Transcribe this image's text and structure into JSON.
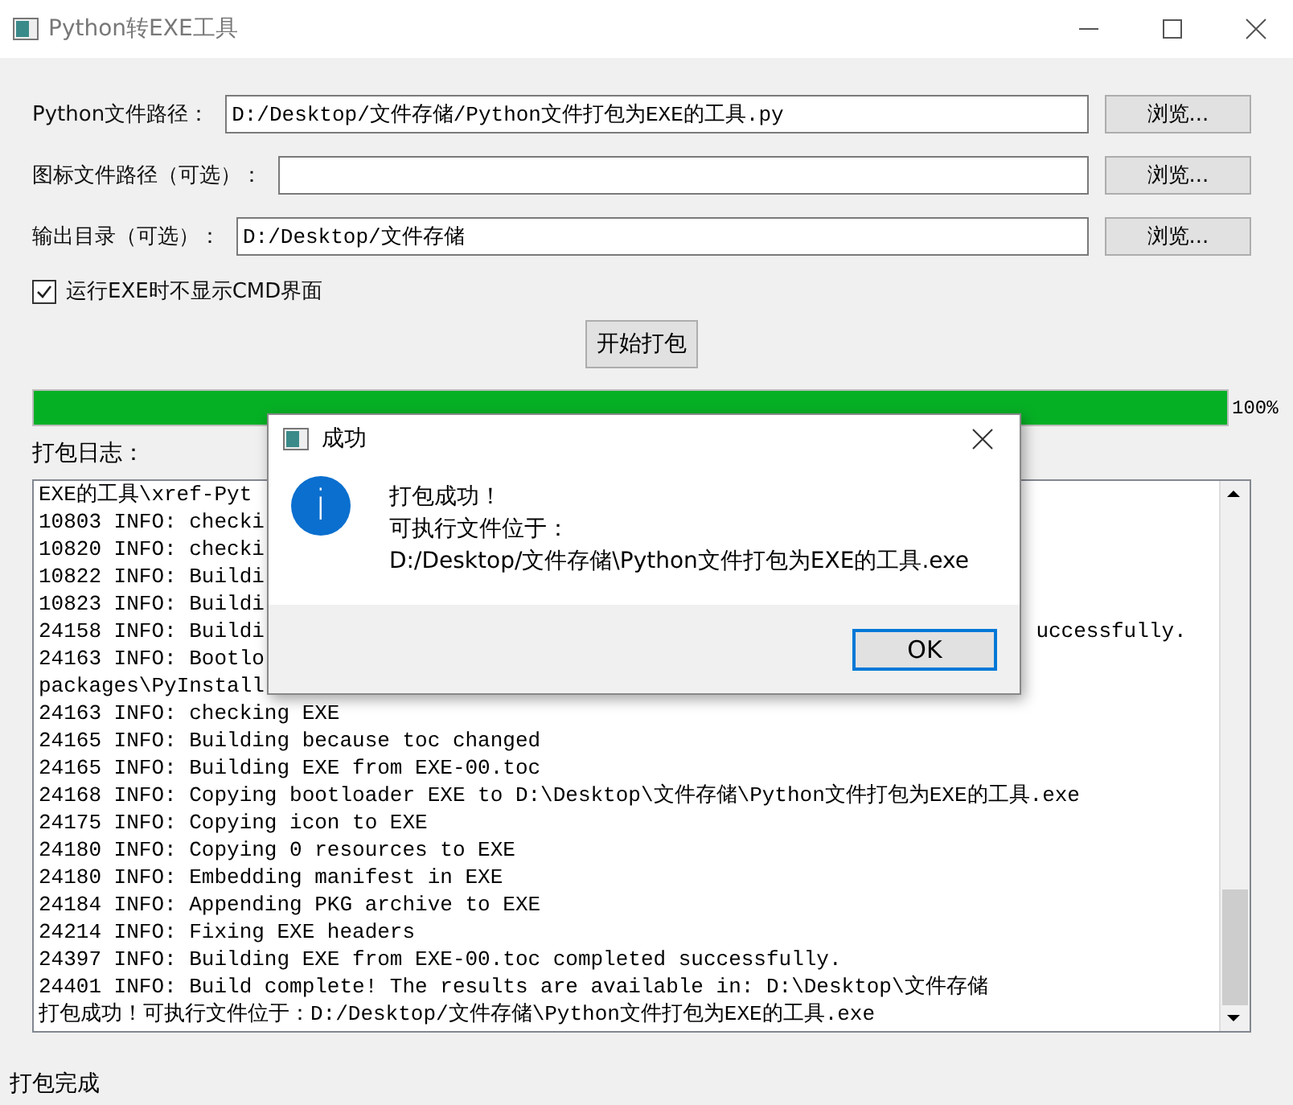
{
  "window": {
    "title": "Python转EXE工具"
  },
  "fields": [
    {
      "label": "Python文件路径：",
      "value": "D:/Desktop/文件存储/Python文件打包为EXE的工具.py",
      "button": "浏览..."
    },
    {
      "label": "图标文件路径（可选）：",
      "button": "浏览..."
    },
    {
      "label": "输出目录（可选）：",
      "value": "D:/Desktop/文件存储",
      "button": "浏览..."
    }
  ],
  "option": {
    "label": "运行EXE时不显示CMD界面",
    "checked": true
  },
  "start_button": "开始打包",
  "progress": {
    "level": 1,
    "reading": "100%"
  },
  "log": {
    "label": "打包日志：",
    "lines": [
      {
        "text": "EXE的工具\\xref-Pyt"
      },
      {
        "text": "10803 INFO: checki"
      },
      {
        "text": "10820 INFO: checki"
      },
      {
        "text": "10822 INFO: Buildi"
      },
      {
        "text": "10823 INFO: Buildi"
      },
      {
        "text": "24158 INFO: Buildi",
        "tail": "uccessfully."
      },
      {
        "text": "24163 INFO: Bootlo"
      },
      {
        "text": "packages\\PyInstall"
      },
      {
        "text": "24163 INFO: checking EXE"
      },
      {
        "text": "24165 INFO: Building because toc changed"
      },
      {
        "text": "24165 INFO: Building EXE from EXE-00.toc"
      },
      {
        "text": "24168 INFO: Copying bootloader EXE to D:\\Desktop\\文件存储\\Python文件打包为EXE的工具.exe"
      },
      {
        "text": "24175 INFO: Copying icon to EXE"
      },
      {
        "text": "24180 INFO: Copying 0 resources to EXE"
      },
      {
        "text": "24180 INFO: Embedding manifest in EXE"
      },
      {
        "text": "24184 INFO: Appending PKG archive to EXE"
      },
      {
        "text": "24214 INFO: Fixing EXE headers"
      },
      {
        "text": "24397 INFO: Building EXE from EXE-00.toc completed successfully."
      },
      {
        "text": "24401 INFO: Build complete! The results are available in: D:\\Desktop\\文件存储"
      },
      {
        "text": "打包成功！可执行文件位于：D:/Desktop/文件存储\\Python文件打包为EXE的工具.exe"
      }
    ]
  },
  "status_bar": "打包完成",
  "dialog": {
    "title": "成功",
    "icon": "i",
    "lines": [
      "打包成功！",
      "可执行文件位于：",
      "D:/Desktop/文件存储\\Python文件打包为EXE的工具.exe"
    ],
    "button": "OK"
  }
}
